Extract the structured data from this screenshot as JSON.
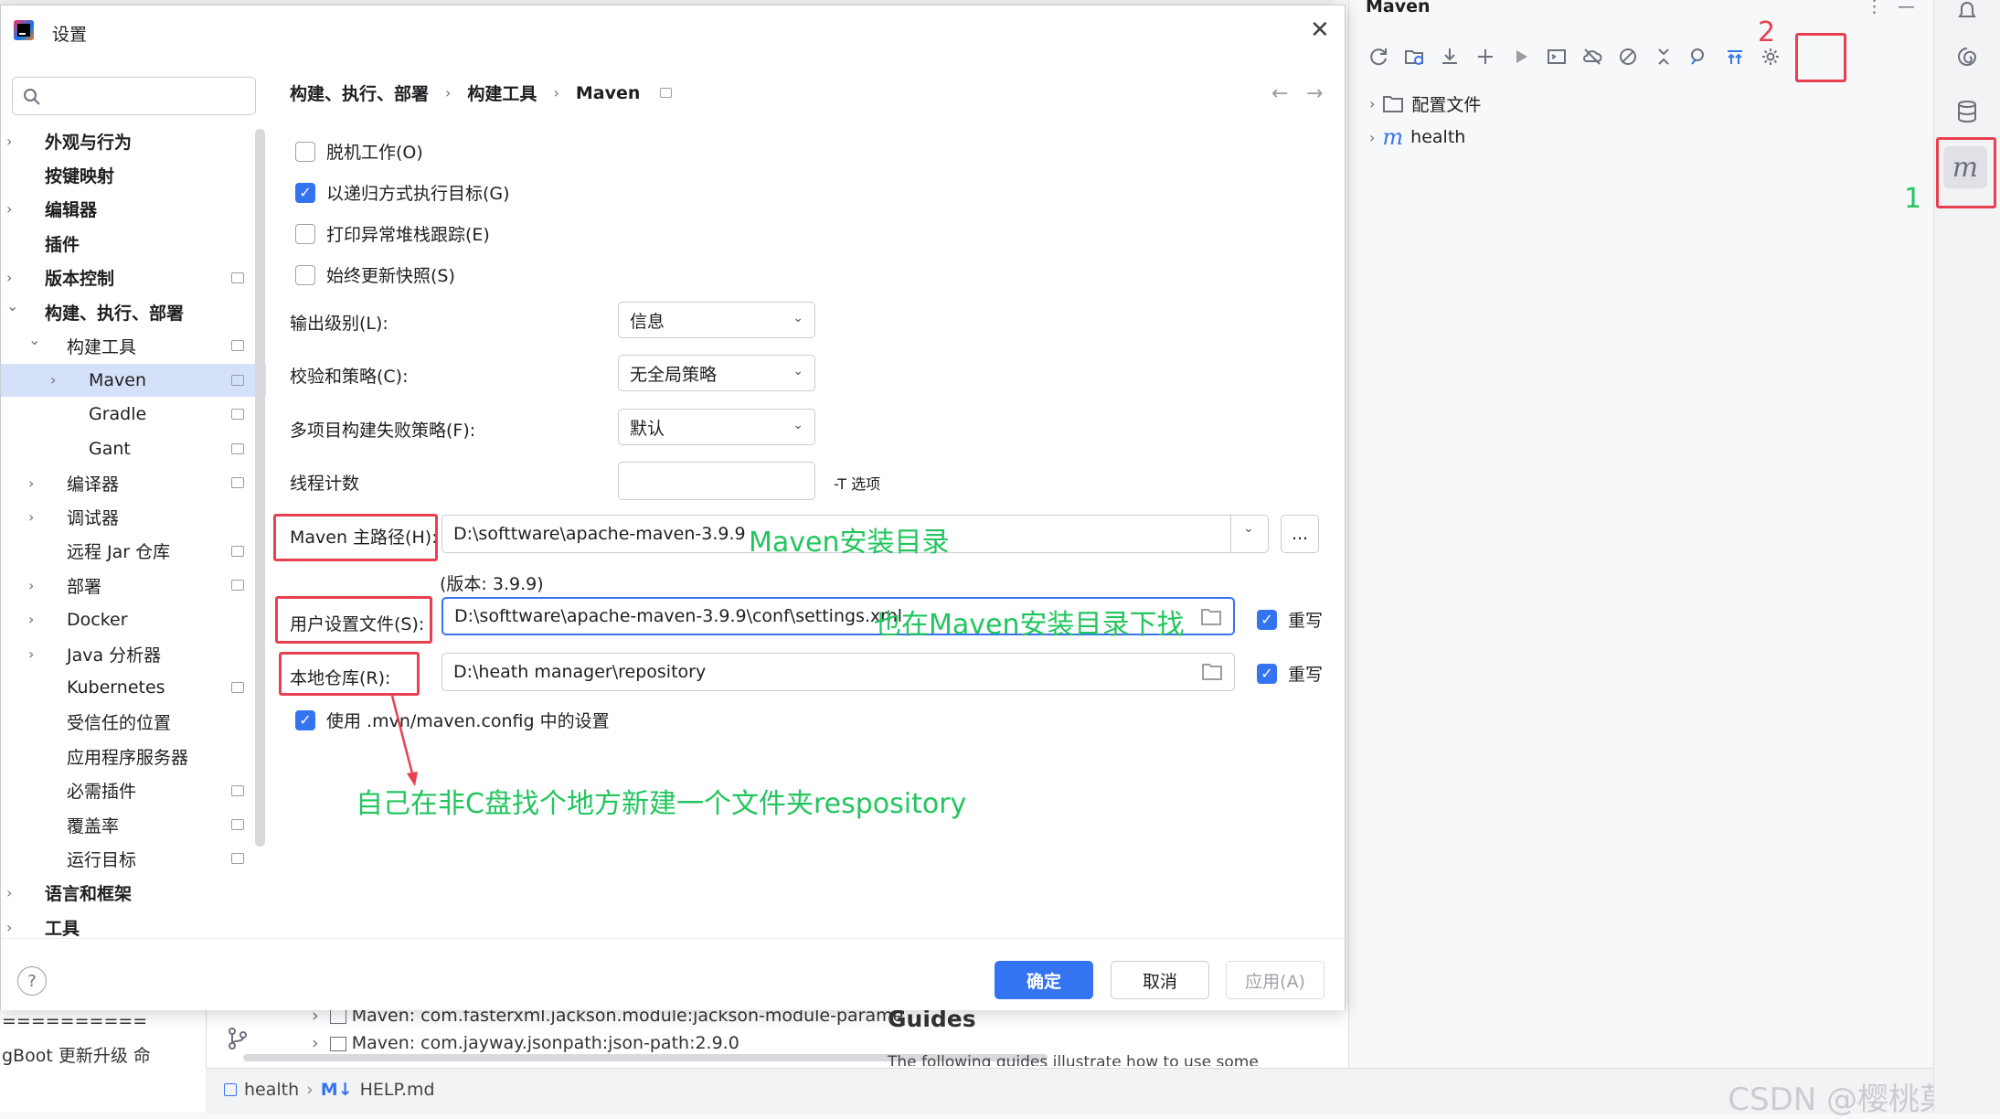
{
  "dialog": {
    "title": "设置",
    "breadcrumb": [
      "构建、执行、部署",
      "构建工具",
      "Maven"
    ],
    "nav": [
      {
        "label": "外观与行为",
        "bold": true,
        "level": 0,
        "chev": true
      },
      {
        "label": "按键映射",
        "bold": true,
        "level": 0,
        "chev": false
      },
      {
        "label": "编辑器",
        "bold": true,
        "level": 0,
        "chev": true
      },
      {
        "label": "插件",
        "bold": true,
        "level": 0,
        "chev": false
      },
      {
        "label": "版本控制",
        "bold": true,
        "level": 0,
        "chev": true,
        "pin": true
      },
      {
        "label": "构建、执行、部署",
        "bold": true,
        "level": 0,
        "chev": true,
        "open": true
      },
      {
        "label": "构建工具",
        "bold": false,
        "level": 1,
        "chev": true,
        "open": true,
        "pin": true
      },
      {
        "label": "Maven",
        "bold": false,
        "level": 2,
        "chev": true,
        "pin": true,
        "selected": true
      },
      {
        "label": "Gradle",
        "bold": false,
        "level": 2,
        "chev": false,
        "pin": true
      },
      {
        "label": "Gant",
        "bold": false,
        "level": 2,
        "chev": false,
        "pin": true
      },
      {
        "label": "编译器",
        "bold": false,
        "level": 1,
        "chev": true,
        "pin": true
      },
      {
        "label": "调试器",
        "bold": false,
        "level": 1,
        "chev": true
      },
      {
        "label": "远程 Jar 仓库",
        "bold": false,
        "level": 1,
        "chev": false,
        "pin": true
      },
      {
        "label": "部署",
        "bold": false,
        "level": 1,
        "chev": true,
        "pin": true
      },
      {
        "label": "Docker",
        "bold": false,
        "level": 1,
        "chev": true
      },
      {
        "label": "Java 分析器",
        "bold": false,
        "level": 1,
        "chev": true
      },
      {
        "label": "Kubernetes",
        "bold": false,
        "level": 1,
        "chev": false,
        "pin": true
      },
      {
        "label": "受信任的位置",
        "bold": false,
        "level": 1,
        "chev": false
      },
      {
        "label": "应用程序服务器",
        "bold": false,
        "level": 1,
        "chev": false
      },
      {
        "label": "必需插件",
        "bold": false,
        "level": 1,
        "chev": false,
        "pin": true
      },
      {
        "label": "覆盖率",
        "bold": false,
        "level": 1,
        "chev": false,
        "pin": true
      },
      {
        "label": "运行目标",
        "bold": false,
        "level": 1,
        "chev": false,
        "pin": true
      },
      {
        "label": "语言和框架",
        "bold": true,
        "level": 0,
        "chev": true
      },
      {
        "label": "工具",
        "bold": true,
        "level": 0,
        "chev": true
      }
    ],
    "options": {
      "offline": {
        "label": "脱机工作(O)",
        "checked": false
      },
      "recursive": {
        "label": "以递归方式执行目标(G)",
        "checked": true
      },
      "stacktrace": {
        "label": "打印异常堆栈跟踪(E)",
        "checked": false
      },
      "snapshots": {
        "label": "始终更新快照(S)",
        "checked": false
      }
    },
    "output_level": {
      "label": "输出级别(L):",
      "value": "信息"
    },
    "checksum": {
      "label": "校验和策略(C):",
      "value": "无全局策略"
    },
    "failure": {
      "label": "多项目构建失败策略(F):",
      "value": "默认"
    },
    "threads": {
      "label": "线程计数",
      "value": "",
      "hint": "-T 选项"
    },
    "maven_home": {
      "label": "Maven 主路径(H):",
      "value": "D:\\softtware\\apache-maven-3.9.9",
      "version": "(版本: 3.9.9)",
      "browse": "..."
    },
    "user_settings": {
      "label": "用户设置文件(S):",
      "value": "D:\\softtware\\apache-maven-3.9.9\\conf\\settings.xml",
      "override": "重写",
      "override_checked": true
    },
    "local_repo": {
      "label": "本地仓库(R):",
      "value": "D:\\heath manager\\repository",
      "override": "重写",
      "override_checked": true
    },
    "mvn_config": {
      "label": "使用 .mvn/maven.config 中的设置",
      "checked": true
    },
    "buttons": {
      "ok": "确定",
      "cancel": "取消",
      "apply": "应用(A)"
    }
  },
  "annotations": {
    "maven_home_note": "Maven安装目录",
    "settings_note": "也在Maven安装目录下找",
    "repo_note": "自己在非C盘找个地方新建一个文件夹respository",
    "num1": "1",
    "num2": "2"
  },
  "maven_panel": {
    "title": "Maven",
    "tree": [
      {
        "label": "配置文件",
        "icon": "folder-icon"
      },
      {
        "label": "health",
        "icon": "maven-m-icon"
      }
    ]
  },
  "background": {
    "bottom_rows": [
      "Maven: com.fasterxml.jackson.module:jackson-module-parame",
      "Maven: com.jayway.jsonpath:json-path:2.9.0"
    ],
    "guides": "Guides",
    "guides_sub": "The following guides illustrate how to use some",
    "left_lines": [
      "==========",
      "gBoot 更新升级 命"
    ],
    "status_project": "health",
    "status_file": "HELP.md",
    "watermark": "CSDN @樱桃菓宝"
  },
  "colors": {
    "accent": "#3574f0",
    "annotation_red": "#e8404f",
    "annotation_green": "#22c55e"
  }
}
